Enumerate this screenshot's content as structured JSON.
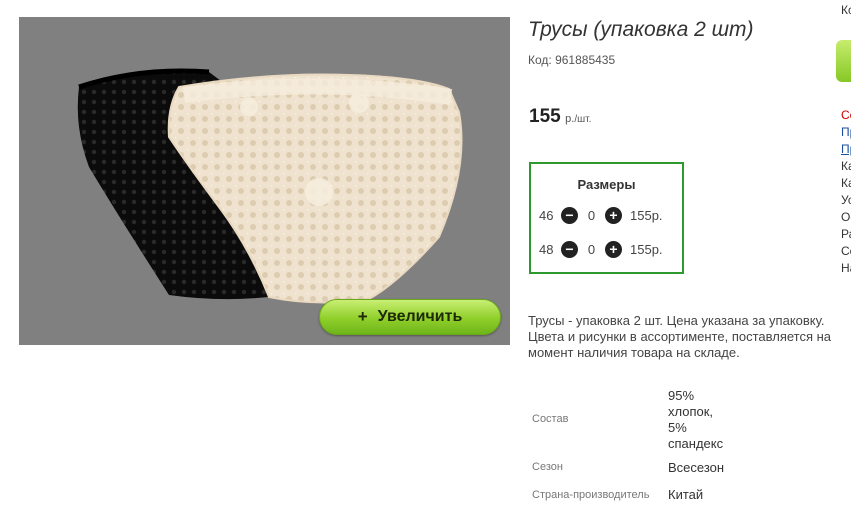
{
  "product": {
    "title": "Трусы (упаковка 2 шт)",
    "code": "Код: 961885435",
    "price": "155",
    "price_unit": "р.",
    "price_per": "/шт.",
    "zoom_label": "Увеличить",
    "zoom_plus": "+"
  },
  "sizes": {
    "title": "Размеры",
    "rows": [
      {
        "size": "46",
        "qty": "0",
        "price": "155р."
      },
      {
        "size": "48",
        "qty": "0",
        "price": "155р."
      }
    ],
    "minus": "−",
    "plus": "+"
  },
  "description": "Трусы - упаковка 2 шт. Цена указана за упаковку. Цвета и рисунки в ассортименте, поставляется на момент наличия товара на складе.",
  "attributes": [
    {
      "label": "Состав",
      "value_lines": [
        "95%",
        "хлопок,",
        "5%",
        "спандекс"
      ]
    },
    {
      "label": "Сезон",
      "value_lines": [
        "Всесезон"
      ]
    },
    {
      "label": "Страна-производитель",
      "value_lines": [
        "Китай"
      ]
    }
  ],
  "side_column": {
    "items": [
      "Кс",
      "Сс",
      "Пр",
      "Пр",
      "Ка",
      "Ка",
      "Ус",
      "Ос",
      "Ра",
      "Сс",
      "На"
    ],
    "colors": [
      "#333333",
      "#cc0000",
      "#1a4fa0",
      "#1a4fa0",
      "#333333",
      "#333333",
      "#333333",
      "#333333",
      "#333333",
      "#333333",
      "#333333"
    ]
  },
  "colors": {
    "accent_green_border": "#2e9a2e",
    "zoom_button": "#8fcf2a",
    "image_background": "#808080"
  }
}
